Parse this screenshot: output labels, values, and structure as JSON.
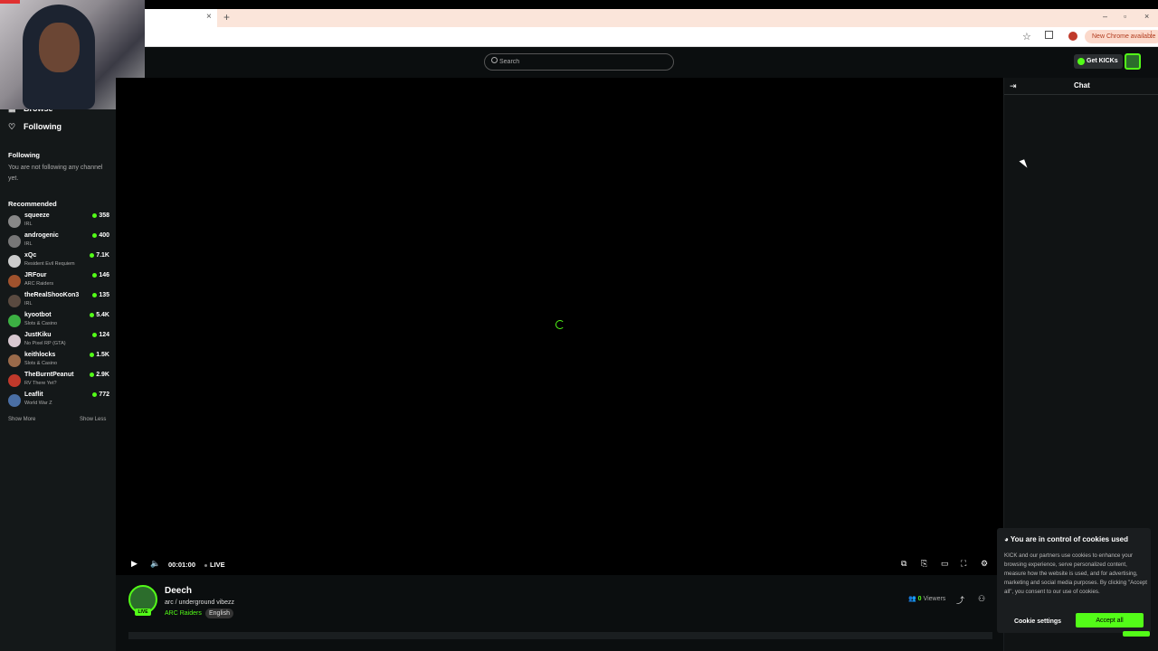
{
  "browser": {
    "new_tab": "+",
    "tab_close": "×",
    "update_label": "New Chrome available",
    "window_controls": [
      "–",
      "▫",
      "×"
    ]
  },
  "header": {
    "search_placeholder": "Search",
    "get_kicks_label": "Get KICKs"
  },
  "sidebar": {
    "nav": [
      {
        "label": "Browse",
        "icon": "browse-icon"
      },
      {
        "label": "Following",
        "icon": "heart-icon"
      }
    ],
    "following_title": "Following",
    "following_empty": "You are not following any channel yet.",
    "recommended_title": "Recommended",
    "recommended": [
      {
        "name": "squeeze",
        "category": "IRL",
        "viewers": "358"
      },
      {
        "name": "androgenic",
        "category": "IRL",
        "viewers": "400"
      },
      {
        "name": "xQc",
        "category": "Resident Evil Requiem",
        "viewers": "7.1K"
      },
      {
        "name": "JRFour",
        "category": "ARC Raiders",
        "viewers": "146"
      },
      {
        "name": "theRealShooKon3",
        "category": "IRL",
        "viewers": "135"
      },
      {
        "name": "kyootbot",
        "category": "Slots & Casino",
        "viewers": "5.4K"
      },
      {
        "name": "JustKiku",
        "category": "No Pixel RP (GTA)",
        "viewers": "124"
      },
      {
        "name": "keithlocks",
        "category": "Slots & Casino",
        "viewers": "1.5K"
      },
      {
        "name": "TheBurntPeanut",
        "category": "RV There Yet?",
        "viewers": "2.9K"
      },
      {
        "name": "Leaflit",
        "category": "World War Z",
        "viewers": "772"
      }
    ],
    "show_more": "Show More",
    "show_less": "Show Less"
  },
  "player": {
    "time": "00:01:00",
    "live_label": "LIVE"
  },
  "stream": {
    "channel_name": "Deech",
    "title": "arc / underground vibezz",
    "category": "ARC Raiders",
    "tag": "English",
    "live_badge": "LIVE",
    "viewers_count": "0",
    "viewers_label": "Viewers"
  },
  "chat": {
    "title": "Chat"
  },
  "cookie": {
    "title": "You are in control of cookies used",
    "body": "KICK and our partners use cookies to enhance your browsing experience, serve personalized content, measure how the website is used, and for advertising, marketing and social media purposes. By clicking \"Accept all\", you consent to our use of cookies.",
    "settings_label": "Cookie settings",
    "accept_label": "Accept all"
  },
  "colors": {
    "accent": "#53fc18",
    "background": "#0b0e0f",
    "sidebar": "#141819"
  }
}
